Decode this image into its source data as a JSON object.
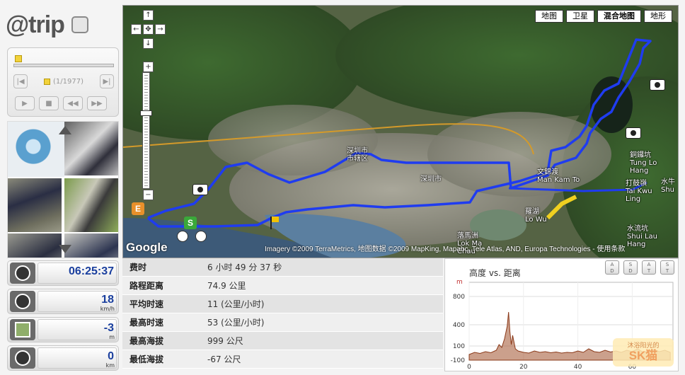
{
  "app": {
    "brand": "@trip"
  },
  "player": {
    "counter": "(1/1977)"
  },
  "gauges": [
    {
      "name": "clock",
      "value": "06:25:37",
      "unit": ""
    },
    {
      "name": "speed",
      "value": "18",
      "unit": "km/h"
    },
    {
      "name": "altitude",
      "value": "-3",
      "unit": "m"
    },
    {
      "name": "distance",
      "value": "0",
      "unit": "km"
    }
  ],
  "map": {
    "types": [
      "地图",
      "卫星",
      "混合地图",
      "地形"
    ],
    "active_type": "混合地图",
    "copyright": "Imagery ©2009 TerraMetrics, 地图数据 ©2009 MapKing, Mapabc, Tele Atlas, AND, Europa Technologies - 使用条款",
    "google_logo": "Google",
    "start_marker": "S",
    "end_marker": "E",
    "labels": [
      {
        "text": "深圳市"
      },
      {
        "text": "深圳市\n市辖区"
      },
      {
        "text": "文錦渡\nMan Kam To"
      },
      {
        "text": "羅湖\nLo Wu"
      },
      {
        "text": "落馬洲\nLok Ma\nChau"
      },
      {
        "text": "銅鑼坑\nTung Lo\nHang"
      },
      {
        "text": "打鼓嶺\nTai Kwu\nLing"
      },
      {
        "text": "水流坑\nShui Lau\nHang"
      },
      {
        "text": "水牛\nShu"
      }
    ]
  },
  "summary": {
    "rows": [
      {
        "label": "费时",
        "value": "6 小时  49 分  37 秒"
      },
      {
        "label": "路程距离",
        "value": "74.9 公里"
      },
      {
        "label": "平均时速",
        "value": "11 (公里/小时)"
      },
      {
        "label": "最高时速",
        "value": "53 (公里/小时)"
      },
      {
        "label": "最高海拔",
        "value": "999 公尺"
      },
      {
        "label": "最低海拔",
        "value": "-67 公尺"
      }
    ]
  },
  "chart_data": {
    "type": "area",
    "title": "高度 vs. 距离",
    "ylabel": "m",
    "xlabel": "",
    "xlim": [
      0,
      75
    ],
    "ylim": [
      -100,
      1000
    ],
    "yticks": [
      800,
      400,
      100,
      -100
    ],
    "xticks": [
      0,
      20,
      40,
      60
    ],
    "x": [
      0,
      2,
      4,
      6,
      8,
      10,
      11,
      12,
      13,
      14,
      14.5,
      15,
      15.5,
      16,
      17,
      18,
      20,
      22,
      24,
      26,
      28,
      30,
      32,
      34,
      36,
      38,
      40,
      42,
      44,
      46,
      48,
      50,
      52,
      54,
      56,
      58,
      60,
      62,
      64,
      66,
      68,
      70,
      72,
      74
    ],
    "y": [
      -20,
      10,
      -5,
      20,
      5,
      40,
      120,
      80,
      200,
      380,
      580,
      300,
      120,
      250,
      60,
      30,
      10,
      0,
      30,
      10,
      20,
      5,
      15,
      0,
      10,
      5,
      30,
      10,
      60,
      20,
      10,
      40,
      15,
      30,
      10,
      40,
      20,
      60,
      10,
      30,
      50,
      20,
      40,
      10
    ],
    "buttons": [
      {
        "top": "A",
        "bottom": "D"
      },
      {
        "top": "S",
        "bottom": "D"
      },
      {
        "top": "A",
        "bottom": "T"
      },
      {
        "top": "S",
        "bottom": "T"
      }
    ]
  },
  "watermark": {
    "line1": "沐浴阳光的",
    "line2": "SK猫"
  }
}
